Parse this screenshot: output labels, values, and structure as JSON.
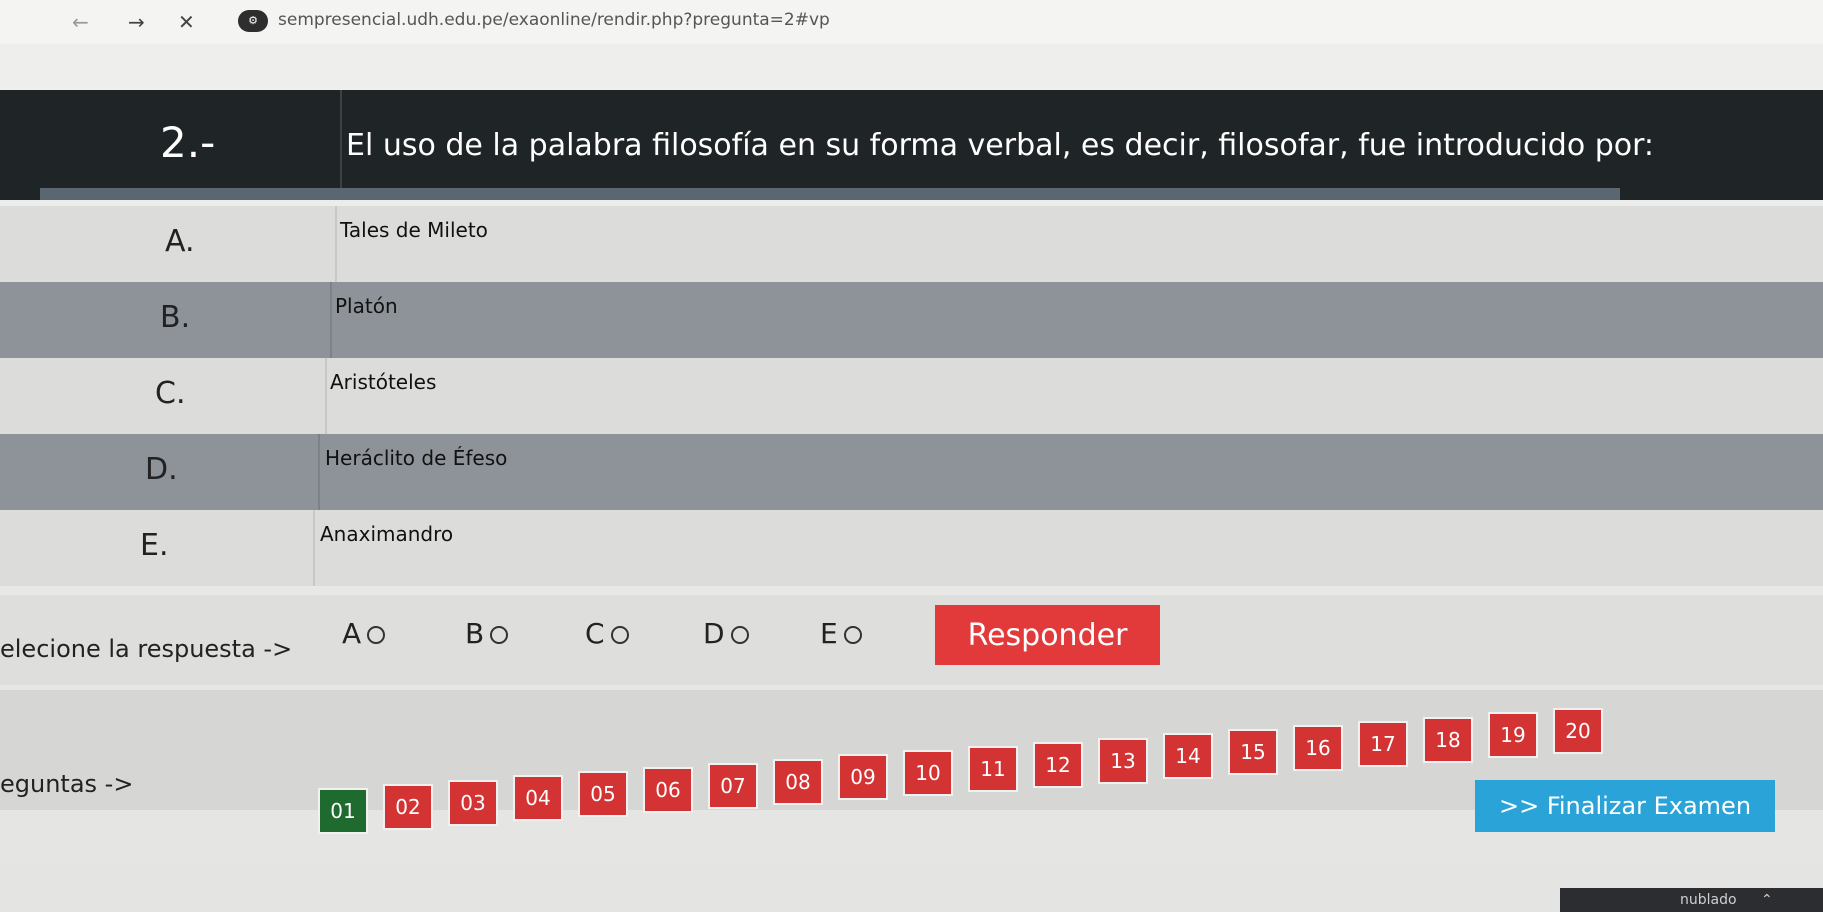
{
  "browser": {
    "back": "←",
    "forward": "→",
    "stop": "✕",
    "url": "sempresencial.udh.edu.pe/exaonline/rendir.php?pregunta=2#vp"
  },
  "question": {
    "number": "2.-",
    "text": "El uso de la palabra filosofía en su forma verbal, es decir, filosofar, fue introducido por:"
  },
  "options": [
    {
      "letter": "A.",
      "text": "Tales de Mileto"
    },
    {
      "letter": "B.",
      "text": "Platón"
    },
    {
      "letter": "C.",
      "text": "Aristóteles"
    },
    {
      "letter": "D.",
      "text": "Heráclito de Éfeso"
    },
    {
      "letter": "E.",
      "text": "Anaximandro"
    }
  ],
  "answer_row": {
    "label": "elecione la respuesta ->",
    "choices": [
      "A",
      "B",
      "C",
      "D",
      "E"
    ],
    "submit_label": "Responder"
  },
  "navigation": {
    "label": "eguntas ->",
    "questions": [
      "01",
      "02",
      "03",
      "04",
      "05",
      "06",
      "07",
      "08",
      "09",
      "10",
      "11",
      "12",
      "13",
      "14",
      "15",
      "16",
      "17",
      "18",
      "19",
      "20"
    ],
    "current": "01"
  },
  "finish_label": ">> Finalizar Examen",
  "taskbar": {
    "weather": "nublado"
  },
  "colors": {
    "header_bg": "#1f2426",
    "question_btn": "#d43333",
    "current_question_btn": "#1f6a2f",
    "responder_btn": "#e23a3a",
    "finalizar_btn": "#2aa4d8"
  }
}
